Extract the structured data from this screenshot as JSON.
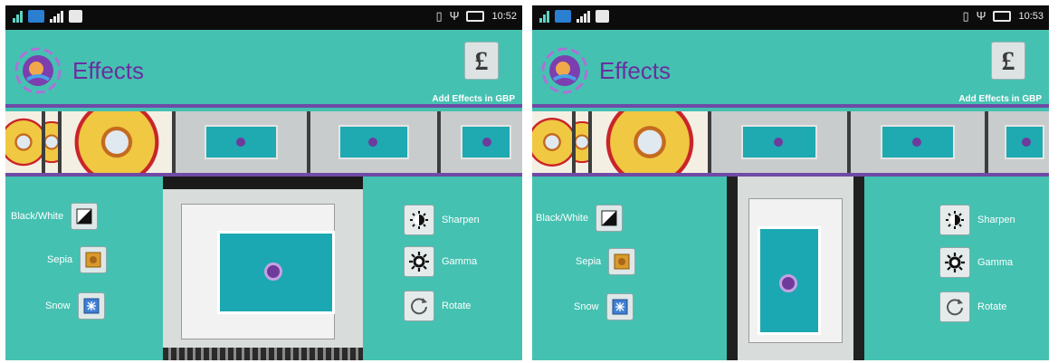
{
  "colors": {
    "background": "#45c1b1",
    "title": "#6b2f9e",
    "divider": "#6f4aa6",
    "status_bar": "#0c0c0c"
  },
  "screens": [
    {
      "status_bar": {
        "time": "10:52",
        "icons": [
          "signal-icon",
          "message-icon",
          "bars-icon",
          "notification-icon",
          "vibrate-icon",
          "usb-icon",
          "battery-icon"
        ]
      },
      "header": {
        "title": "Effects",
        "price_symbol": "£",
        "price_caption": "Add Effects in GBP"
      },
      "effects_left": [
        "Black/White",
        "Sepia",
        "Snow"
      ],
      "effects_right": [
        "Sharpen",
        "Gamma",
        "Rotate"
      ]
    },
    {
      "status_bar": {
        "time": "10:53",
        "icons": [
          "signal-icon",
          "message-icon",
          "bars-icon",
          "notification-icon",
          "vibrate-icon",
          "usb-icon",
          "battery-icon"
        ]
      },
      "header": {
        "title": "Effects",
        "price_symbol": "£",
        "price_caption": "Add Effects in GBP"
      },
      "effects_left": [
        "Black/White",
        "Sepia",
        "Snow"
      ],
      "effects_right": [
        "Sharpen",
        "Gamma",
        "Rotate"
      ]
    }
  ]
}
